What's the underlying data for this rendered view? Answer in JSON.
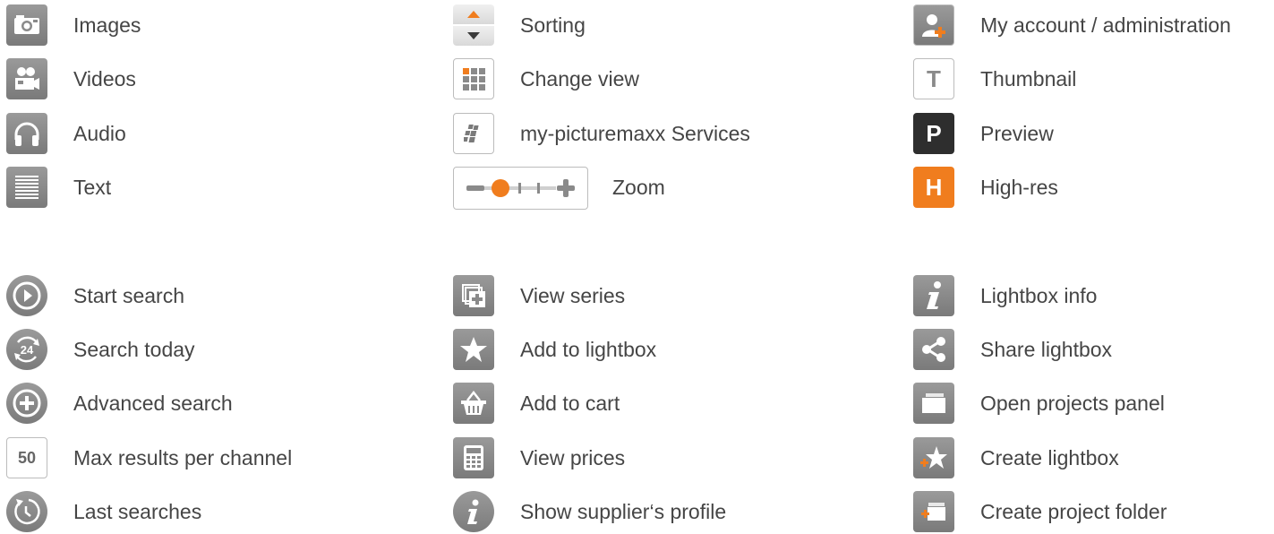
{
  "col1": {
    "images": "Images",
    "videos": "Videos",
    "audio": "Audio",
    "text": "Text",
    "start_search": "Start search",
    "search_today": "Search today",
    "search_today_badge": "24",
    "advanced_search": "Advanced search",
    "max_results": "Max results per channel",
    "max_results_badge": "50",
    "last_searches": "Last searches"
  },
  "col2": {
    "sorting": "Sorting",
    "change_view": "Change view",
    "services": "my-picturemaxx Services",
    "zoom": "Zoom",
    "view_series": "View series",
    "add_lightbox": "Add to lightbox",
    "add_cart": "Add to cart",
    "view_prices": "View prices",
    "supplier_profile": "Show supplier‘s profile"
  },
  "col3": {
    "account": "My account / administration",
    "thumbnail": "Thumbnail",
    "thumbnail_badge": "T",
    "preview": "Preview",
    "preview_badge": "P",
    "highres": "High-res",
    "highres_badge": "H",
    "lightbox_info": "Lightbox info",
    "share_lightbox": "Share lightbox",
    "projects_panel": "Open projects panel",
    "create_lightbox": "Create lightbox",
    "create_folder": "Create project folder"
  },
  "colors": {
    "accent": "#f07d1e",
    "icon_gray": "#8a8a8a",
    "text": "#454545"
  }
}
